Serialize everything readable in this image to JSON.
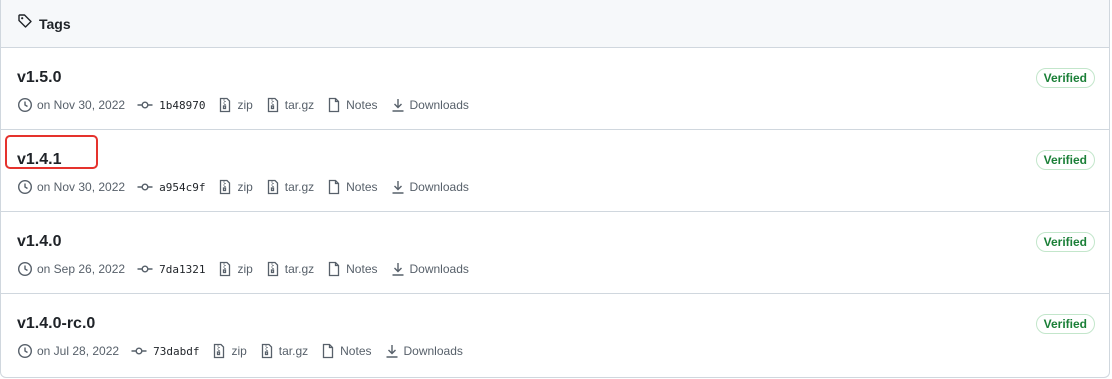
{
  "header": {
    "title": "Tags"
  },
  "tags": [
    {
      "name": "v1.5.0",
      "date": "on Nov 30, 2022",
      "commit": "1b48970",
      "zip": "zip",
      "tar": "tar.gz",
      "notes": "Notes",
      "downloads": "Downloads",
      "verified": "Verified"
    },
    {
      "name": "v1.4.1",
      "date": "on Nov 30, 2022",
      "commit": "a954c9f",
      "zip": "zip",
      "tar": "tar.gz",
      "notes": "Notes",
      "downloads": "Downloads",
      "verified": "Verified"
    },
    {
      "name": "v1.4.0",
      "date": "on Sep 26, 2022",
      "commit": "7da1321",
      "zip": "zip",
      "tar": "tar.gz",
      "notes": "Notes",
      "downloads": "Downloads",
      "verified": "Verified"
    },
    {
      "name": "v1.4.0-rc.0",
      "date": "on Jul 28, 2022",
      "commit": "73dabdf",
      "zip": "zip",
      "tar": "tar.gz",
      "notes": "Notes",
      "downloads": "Downloads",
      "verified": "Verified"
    }
  ],
  "colors": {
    "verified": "#1a7f37",
    "highlight": "#e5322d",
    "muted": "#57606a",
    "border": "#d0d7de"
  }
}
